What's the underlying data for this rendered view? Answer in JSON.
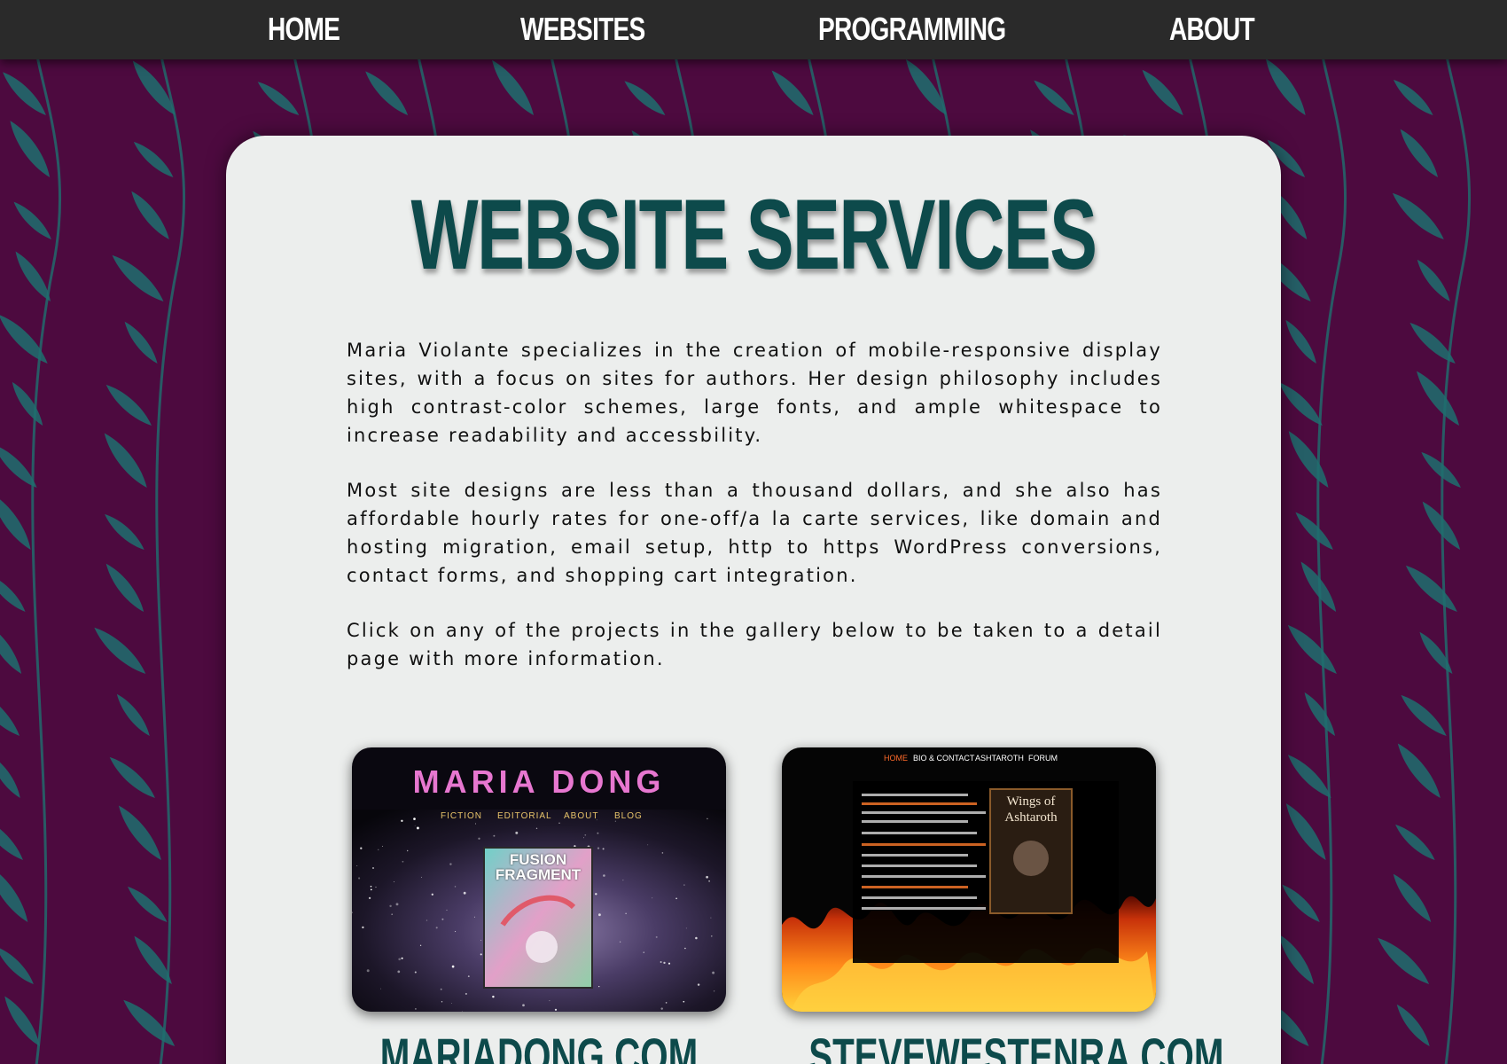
{
  "nav": {
    "items": [
      {
        "label": "HOME"
      },
      {
        "label": "WEBSITES"
      },
      {
        "label": "PROGRAMMING"
      },
      {
        "label": "ABOUT"
      }
    ]
  },
  "page": {
    "title": "WEBSITE SERVICES",
    "paragraphs": [
      "Maria Violante specializes in the creation of mobile-responsive display sites, with a focus on sites for authors. Her design philosophy includes high contrast-color schemes, large fonts, and ample whitespace to increase readability and accessbility.",
      "Most site designs are less than a thousand dollars, and she also has affordable hourly rates for one-off/a la carte services, like domain and hosting migration, email setup, http to https WordPress conversions, contact forms, and shopping cart integration.",
      "Click on any of the projects in the gallery below to be taken to a detail page with more information."
    ]
  },
  "gallery": [
    {
      "caption": "MARIADONG.COM",
      "thumb": {
        "site_title": "MARIA DONG",
        "menu": [
          "FICTION",
          "EDITORIAL",
          "ABOUT",
          "BLOG"
        ],
        "cover_title": "FUSION FRAGMENT"
      }
    },
    {
      "caption": "STEVEWESTENRA.COM",
      "thumb": {
        "menu": [
          "HOME",
          "BIO & CONTACT",
          "ASHTAROTH",
          "FORUM"
        ],
        "book_title": "Wings of Ashtaroth"
      }
    }
  ],
  "colors": {
    "nav_bg": "#2a2a2a",
    "page_bg": "#4d0a3f",
    "leaf": "#1f6f6f",
    "card_bg": "#eceeed",
    "title": "#0d4a4b"
  }
}
